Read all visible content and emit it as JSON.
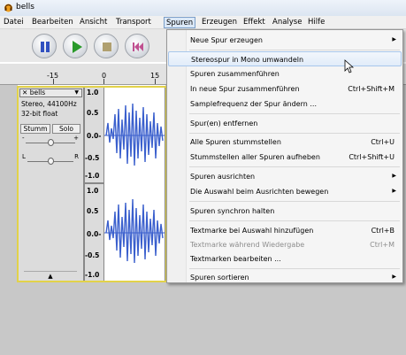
{
  "window": {
    "title": "bells"
  },
  "menubar": [
    "Datei",
    "Bearbeiten",
    "Ansicht",
    "Transport",
    "Spuren",
    "Erzeugen",
    "Effekt",
    "Analyse",
    "Hilfe"
  ],
  "toolbar": {
    "buttons": [
      "pause-button",
      "play-button",
      "stop-button",
      "skip-to-start-button"
    ]
  },
  "ruler": {
    "labels": [
      "-15",
      "0",
      "15"
    ]
  },
  "track": {
    "name": "bells",
    "format_line1": "Stereo, 44100Hz",
    "format_line2": "32-bit float",
    "mute_label": "Stumm",
    "solo_label": "Solo",
    "gain_minus": "-",
    "gain_plus": "+",
    "pan_left": "L",
    "pan_right": "R",
    "collapse_symbol": "▲",
    "scale_upper": [
      "1.0",
      "0.5",
      "0.0-",
      "-0.5",
      "-1.0"
    ],
    "scale_lower": [
      "1.0",
      "0.5",
      "0.0-",
      "-0.5",
      "-1.0"
    ]
  },
  "spuren_menu": {
    "items": [
      {
        "label": "Neue Spur erzeugen",
        "shortcut": "",
        "submenu": true,
        "disabled": false
      },
      {
        "label": "Stereospur in Mono umwandeln",
        "shortcut": "",
        "submenu": false,
        "disabled": false,
        "hover": true
      },
      {
        "label": "Spuren zusammenführen",
        "shortcut": "",
        "submenu": false,
        "disabled": false
      },
      {
        "label": "In neue Spur zusammenführen",
        "shortcut": "Ctrl+Shift+M",
        "submenu": false,
        "disabled": false
      },
      {
        "label": "Samplefrequenz der Spur ändern ...",
        "shortcut": "",
        "submenu": false,
        "disabled": false
      },
      {
        "label": "Spur(en) entfernen",
        "shortcut": "",
        "submenu": false,
        "disabled": false
      },
      {
        "label": "Alle Spuren stummstellen",
        "shortcut": "Ctrl+U",
        "submenu": false,
        "disabled": false
      },
      {
        "label": "Stummstellen aller Spuren aufheben",
        "shortcut": "Ctrl+Shift+U",
        "submenu": false,
        "disabled": false
      },
      {
        "label": "Spuren ausrichten",
        "shortcut": "",
        "submenu": true,
        "disabled": false
      },
      {
        "label": "Die Auswahl beim Ausrichten bewegen",
        "shortcut": "",
        "submenu": true,
        "disabled": false
      },
      {
        "label": "Spuren synchron halten",
        "shortcut": "",
        "submenu": false,
        "disabled": false
      },
      {
        "label": "Textmarke bei Auswahl hinzufügen",
        "shortcut": "Ctrl+B",
        "submenu": false,
        "disabled": false
      },
      {
        "label": "Textmarke während Wiedergabe",
        "shortcut": "Ctrl+M",
        "submenu": false,
        "disabled": true
      },
      {
        "label": "Textmarken bearbeiten ...",
        "shortcut": "",
        "submenu": false,
        "disabled": false
      },
      {
        "label": "Spuren sortieren",
        "shortcut": "",
        "submenu": true,
        "disabled": false
      }
    ]
  },
  "colors": {
    "accent": "#3366cc",
    "menu_hover": "#dbe8f7",
    "waveform": "#3a5fcd",
    "selection_border": "#e2d24a"
  }
}
